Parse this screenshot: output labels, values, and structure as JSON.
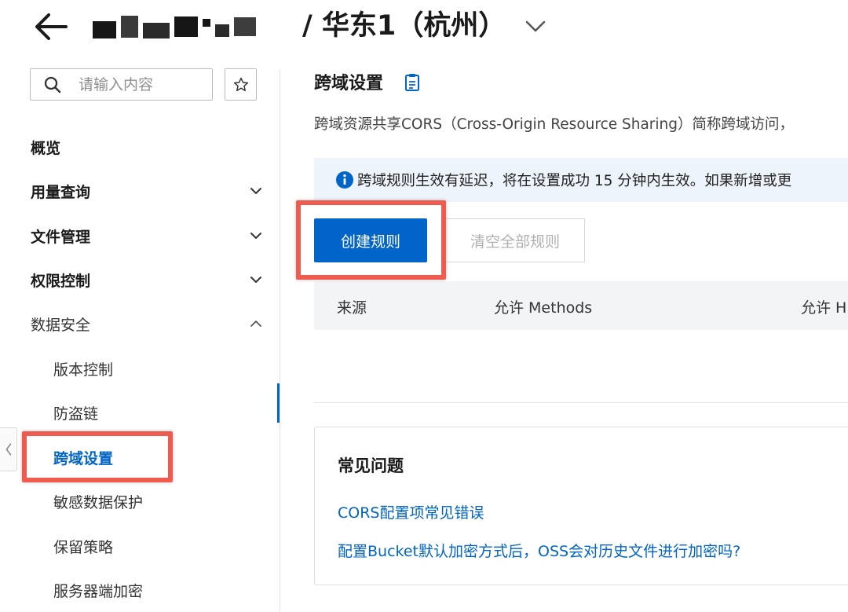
{
  "header": {
    "region_title": "/ 华东1（杭州）"
  },
  "sidebar": {
    "search": {
      "placeholder": "请输入内容"
    },
    "items": [
      {
        "label": "概览"
      },
      {
        "label": "用量查询"
      },
      {
        "label": "文件管理"
      },
      {
        "label": "权限控制"
      },
      {
        "label": "数据安全"
      }
    ],
    "sub_items": [
      {
        "label": "版本控制"
      },
      {
        "label": "防盗链"
      },
      {
        "label": "跨域设置"
      },
      {
        "label": "敏感数据保护"
      },
      {
        "label": "保留策略"
      },
      {
        "label": "服务器端加密"
      }
    ]
  },
  "main": {
    "title": "跨域设置",
    "description": "跨域资源共享CORS（Cross-Origin Resource Sharing）简称跨域访问，",
    "notice": "跨域规则生效有延迟，将在设置成功 15 分钟内生效。如果新增或更",
    "create_button": "创建规则",
    "clear_button": "清空全部规则",
    "table": {
      "columns": [
        "来源",
        "允许 Methods",
        "允许 H"
      ]
    },
    "faq": {
      "title": "常见问题",
      "links": [
        "CORS配置项常见错误",
        "配置Bucket默认加密方式后，OSS会对历史文件进行加密吗?"
      ]
    }
  },
  "colors": {
    "primary": "#0064c8",
    "highlight": "#ef5b4f",
    "notice_bg": "#eef4fb"
  }
}
